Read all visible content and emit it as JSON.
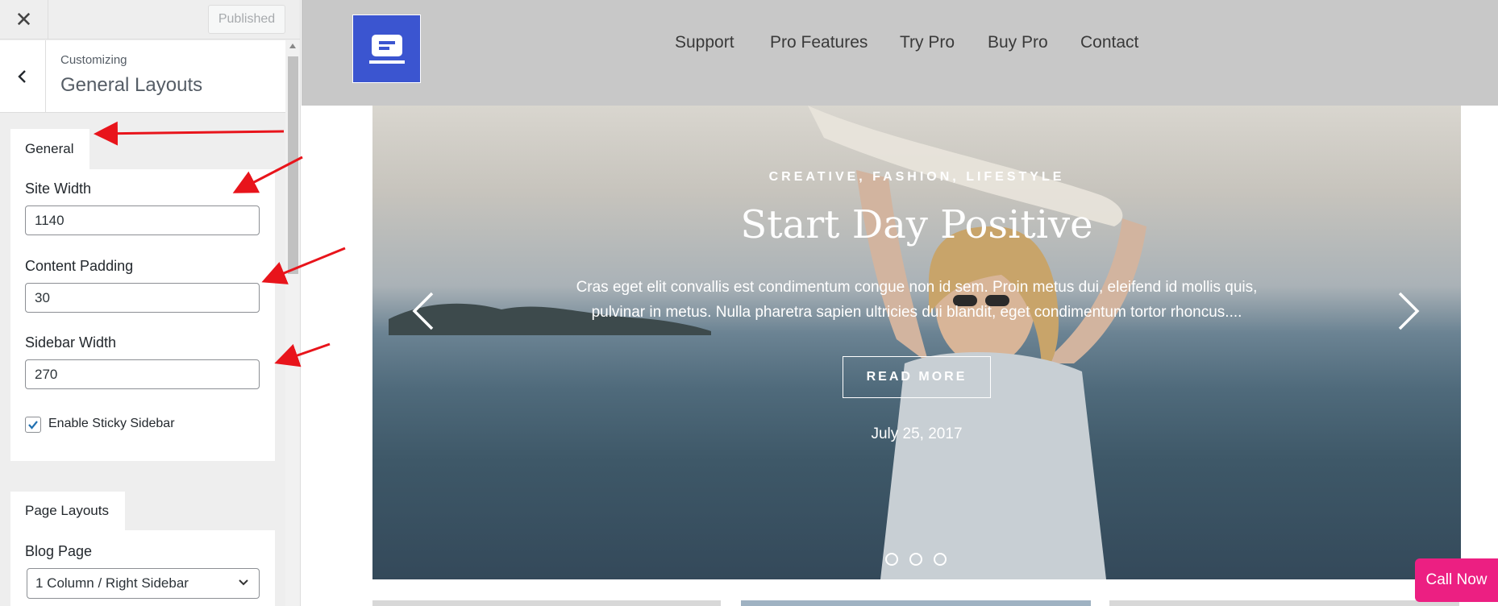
{
  "customizer": {
    "close_label": "✕",
    "publish_label": "Published",
    "breadcrumb": "Customizing",
    "section_title": "General Layouts",
    "general_tab": "General",
    "fields": {
      "site_width": {
        "label": "Site Width",
        "value": "1140"
      },
      "content_padding": {
        "label": "Content Padding",
        "value": "30"
      },
      "sidebar_width": {
        "label": "Sidebar Width",
        "value": "270"
      }
    },
    "sticky_sidebar": {
      "label": "Enable Sticky Sidebar",
      "checked": true
    },
    "page_layouts_tab": "Page Layouts",
    "blog_page": {
      "label": "Blog Page",
      "value": "1 Column / Right Sidebar"
    }
  },
  "site": {
    "nav": [
      "Support",
      "Pro Features",
      "Try Pro",
      "Buy Pro",
      "Contact"
    ],
    "hero": {
      "categories": "CREATIVE, FASHION, LIFESTYLE",
      "title": "Start Day Positive",
      "excerpt": "Cras eget elit convallis est condimentum congue non id sem. Proin metus dui, eleifend id mollis quis, pulvinar in metus. Nulla pharetra sapien ultricies dui blandit, eget condimentum tortor rhoncus....",
      "button": "READ MORE",
      "date": "July 25, 2017",
      "slide_count": 3
    },
    "call_now": "Call Now"
  },
  "colors": {
    "logo_bg": "#3b55d0",
    "call_now_bg": "#ec1f82",
    "annotation_arrow": "#e8141b"
  },
  "icons": {
    "close": "close-icon",
    "back": "chevron-left-icon",
    "logo": "logo-icon",
    "prev": "chevron-left-icon",
    "next": "chevron-right-icon",
    "select": "chevron-down-icon",
    "check": "checkmark-icon"
  }
}
